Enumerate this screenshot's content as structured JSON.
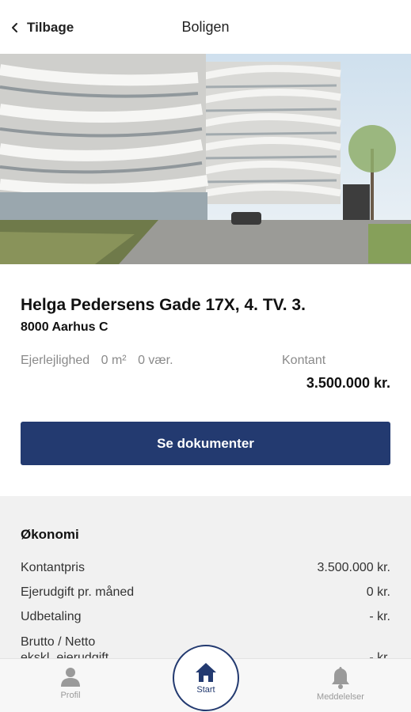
{
  "header": {
    "back_label": "Tilbage",
    "title": "Boligen"
  },
  "property": {
    "address": "Helga Pedersens Gade 17X, 4. TV. 3.",
    "city": "8000 Aarhus C",
    "type": "Ejerlejlighed",
    "area": "0 m²",
    "rooms": "0 vær.",
    "price_label": "Kontant",
    "price": "3.500.000 kr."
  },
  "documents_button": "Se dokumenter",
  "economy": {
    "title": "Økonomi",
    "rows": [
      {
        "label": "Kontantpris",
        "value": "3.500.000 kr."
      },
      {
        "label": "Ejerudgift pr. måned",
        "value": "0 kr."
      },
      {
        "label": "Udbetaling",
        "value": "- kr."
      },
      {
        "label": "Brutto / Netto",
        "value": ""
      },
      {
        "label": "ekskl. ejerudgift",
        "value": "- kr."
      }
    ]
  },
  "nav": {
    "profil": "Profil",
    "start": "Start",
    "meddelelser": "Meddelelser"
  },
  "colors": {
    "brand": "#233a70",
    "economy_bg": "#f1f1f1"
  }
}
